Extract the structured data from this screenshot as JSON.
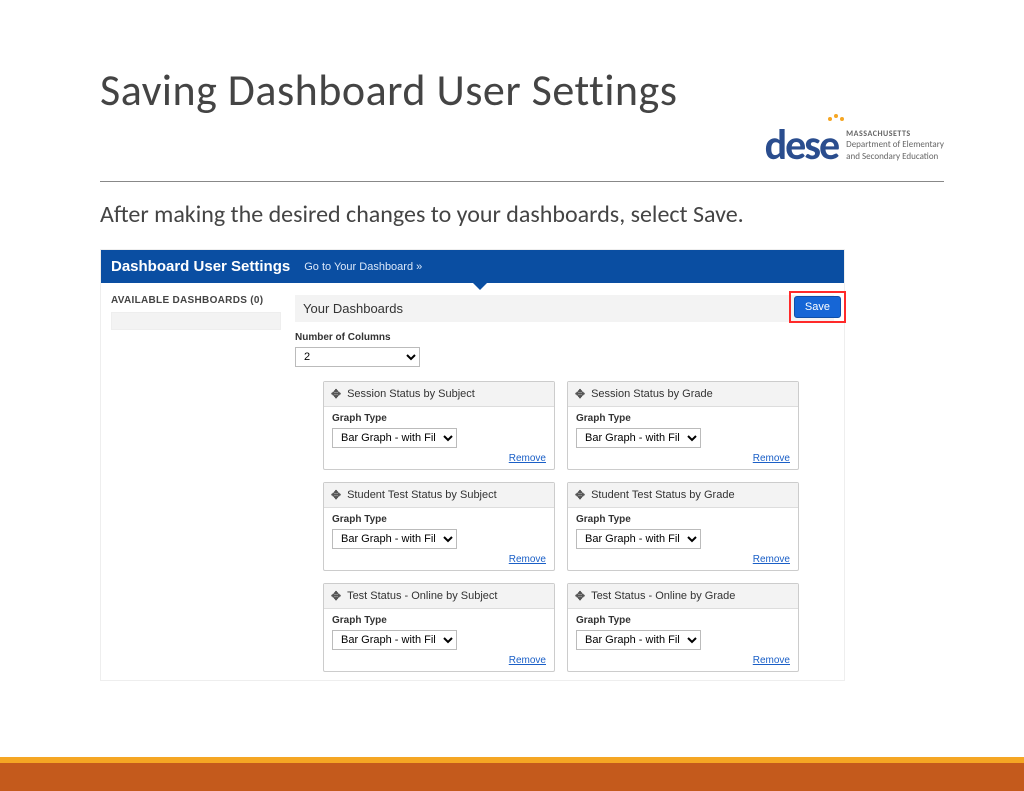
{
  "page": {
    "title": "Saving Dashboard User Settings",
    "subtitle": "After making the desired changes to your dashboards, select Save."
  },
  "logo": {
    "word": "dese",
    "state": "MASSACHUSETTS",
    "line1": "Department of Elementary",
    "line2": "and Secondary Education"
  },
  "app": {
    "header_title": "Dashboard User Settings",
    "header_link": "Go to Your Dashboard »",
    "available_label": "AVAILABLE DASHBOARDS (0)",
    "your_dashboards_label": "Your Dashboards",
    "save_label": "Save",
    "num_cols_label": "Number of Columns",
    "num_cols_value": "2",
    "graph_type_label": "Graph Type",
    "graph_type_value": "Bar Graph - with Filter",
    "remove_label": "Remove",
    "cards": [
      {
        "title": "Session Status by Subject"
      },
      {
        "title": "Session Status by Grade"
      },
      {
        "title": "Student Test Status by Subject"
      },
      {
        "title": "Student Test Status by Grade"
      },
      {
        "title": "Test Status - Online by Subject"
      },
      {
        "title": "Test Status - Online by Grade"
      }
    ]
  }
}
